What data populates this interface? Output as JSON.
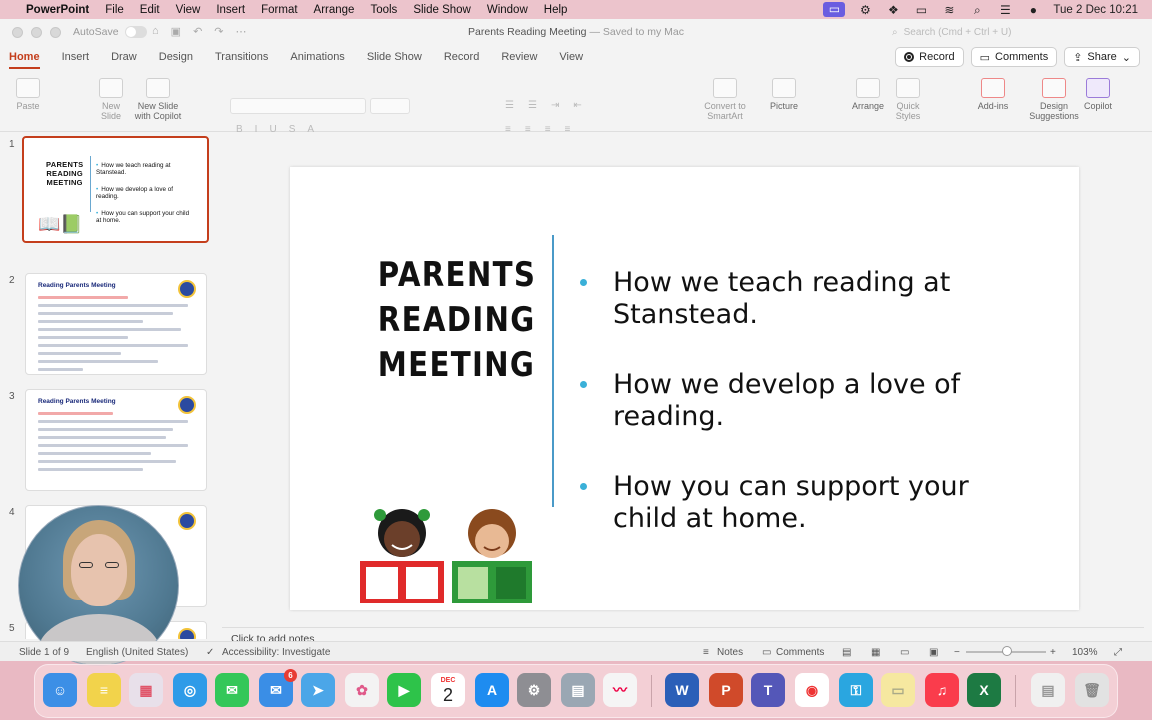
{
  "menubar": {
    "app": "PowerPoint",
    "items": [
      "File",
      "Edit",
      "View",
      "Insert",
      "Format",
      "Arrange",
      "Tools",
      "Slide Show",
      "Window",
      "Help"
    ],
    "clock": "Tue 2 Dec  10:21"
  },
  "titlebar": {
    "autosave_label": "AutoSave",
    "doc_title": "Parents Reading Meeting",
    "saved_status": "— Saved to my Mac",
    "search_placeholder": "Search (Cmd + Ctrl + U)"
  },
  "ribbon_tabs": [
    "Home",
    "Insert",
    "Draw",
    "Design",
    "Transitions",
    "Animations",
    "Slide Show",
    "Record",
    "Review",
    "View"
  ],
  "ribbon_actions": {
    "record": "Record",
    "comments": "Comments",
    "share": "Share"
  },
  "ribbon": {
    "paste": "Paste",
    "new_slide": "New Slide",
    "new_slide_copilot": "New Slide with Copilot",
    "convert_smartart": "Convert to SmartArt",
    "picture": "Picture",
    "arrange": "Arrange",
    "quick_styles": "Quick Styles",
    "addins": "Add-ins",
    "design_suggestions": "Design Suggestions",
    "copilot": "Copilot"
  },
  "thumbnails": {
    "numbers": [
      "1",
      "2",
      "3",
      "4",
      "5"
    ],
    "slide1": {
      "title_lines": [
        "PARENTS",
        "READING",
        "MEETING"
      ],
      "bullets": [
        "How we teach reading at Stanstead.",
        "How we develop a love of reading.",
        "How you can support your child at home."
      ]
    },
    "slide2_title": "Reading Parents Meeting",
    "slide3_title": "Reading Parents Meeting"
  },
  "slide": {
    "title_lines": [
      "PARENTS",
      "READING",
      "MEETING"
    ],
    "bullets": [
      "How we teach reading at Stanstead.",
      "How we develop a love of reading.",
      "How you can support your child at home."
    ]
  },
  "notes_placeholder": "Click to add notes",
  "statusbar": {
    "slide_count": "Slide 1 of 9",
    "language": "English (United States)",
    "accessibility": "Accessibility: Investigate",
    "notes": "Notes",
    "comments": "Comments",
    "zoom": "103%"
  },
  "dock": {
    "calendar_month": "DEC",
    "calendar_day": "2",
    "mail_badge": "6"
  },
  "colors": {
    "accent": "#c43e1c",
    "bullet": "#3ab0d8",
    "divider": "#4a9ac8"
  }
}
